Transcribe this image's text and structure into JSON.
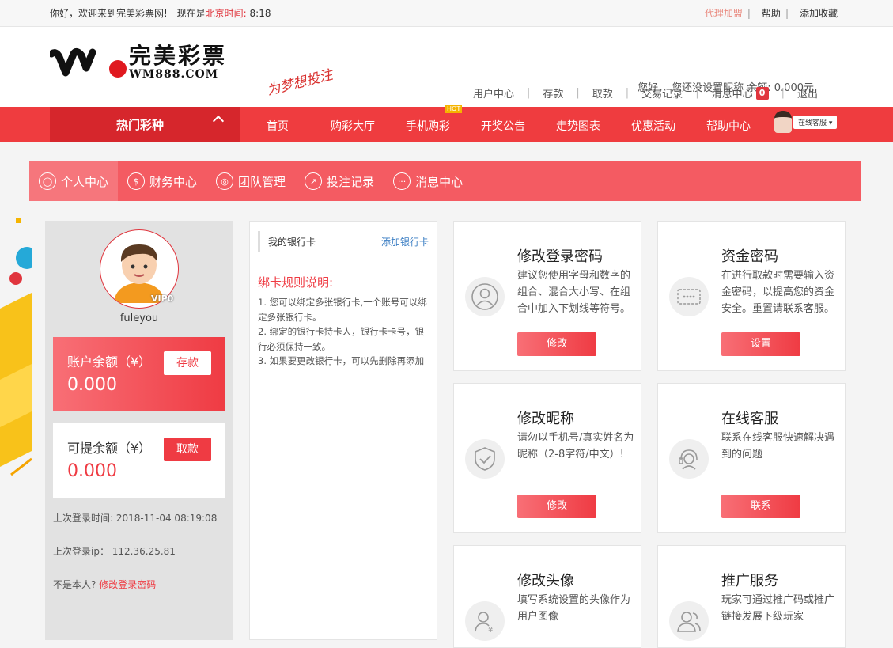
{
  "topbar": {
    "welcome": "你好，欢迎来到完美彩票网!",
    "now_prefix": "现在是",
    "time_label": "北京时间:",
    "time": "8:18",
    "agent": "代理加盟",
    "help": "帮助",
    "favorite": "添加收藏",
    "sep": "|"
  },
  "header": {
    "logo_cn": "完美彩票",
    "logo_en": "WM888.COM",
    "slogan": "为梦想投注",
    "greeting": "您好，  您还没设置昵称  余额:",
    "balance": "0.000元",
    "nav": [
      "用户中心",
      "存款",
      "取款",
      "交易记录",
      "消息中心",
      "退出"
    ],
    "message_count": "0"
  },
  "navbar": {
    "hot_category": "热门彩种",
    "items": [
      "首页",
      "购彩大厅",
      "手机购彩",
      "开奖公告",
      "走势图表",
      "优惠活动",
      "帮助中心"
    ],
    "hot_tag": "HOT",
    "service": "在线客服"
  },
  "tabs": [
    "个人中心",
    "财务中心",
    "团队管理",
    "投注记录",
    "消息中心"
  ],
  "account": {
    "vip": "VIP0",
    "username": "fuleyou",
    "balance_label": "账户余额（¥）",
    "balance": "0.000",
    "deposit_btn": "存款",
    "withdrawable_label": "可提余额（¥）",
    "withdrawable": "0.000",
    "withdraw_btn": "取款",
    "last_login_time_label": "上次登录时间:",
    "last_login_time": "2018-11-04 08:19:08",
    "last_login_ip_label": "上次登录ip：",
    "last_login_ip": "112.36.25.81",
    "not_me": "不是本人?",
    "change_pwd_link": "修改登录密码"
  },
  "bank": {
    "title": "我的银行卡",
    "add": "添加银行卡",
    "rules_title": "绑卡规则说明:",
    "rules": [
      "1. 您可以绑定多张银行卡,一个账号可以绑定多张银行卡。",
      "2. 绑定的银行卡持卡人，银行卡卡号，银行必须保持一致。",
      "3. 如果要更改银行卡，可以先删除再添加"
    ]
  },
  "cards": [
    {
      "title": "修改登录密码",
      "desc": "建议您使用字母和数字的组合、混合大小写、在组合中加入下划线等符号。",
      "button": "修改",
      "icon": "user-icon"
    },
    {
      "title": "资金密码",
      "desc": "在进行取款时需要输入资金密码，以提高您的资金安全。重置请联系客服。",
      "button": "设置",
      "icon": "password-icon"
    },
    {
      "title": "修改昵称",
      "desc": "请勿以手机号/真实姓名为昵称（2-8字符/中文）!",
      "button": "修改",
      "icon": "shield-icon"
    },
    {
      "title": "在线客服",
      "desc": "联系在线客服快速解决遇到的问题",
      "button": "联系",
      "icon": "headset-icon"
    },
    {
      "title": "修改头像",
      "desc": "填写系统设置的头像作为用户图像",
      "button": "",
      "icon": "avatar-icon"
    },
    {
      "title": "推广服务",
      "desc": "玩家可通过推广码或推广链接发展下级玩家",
      "button": "",
      "icon": "users-icon"
    }
  ]
}
